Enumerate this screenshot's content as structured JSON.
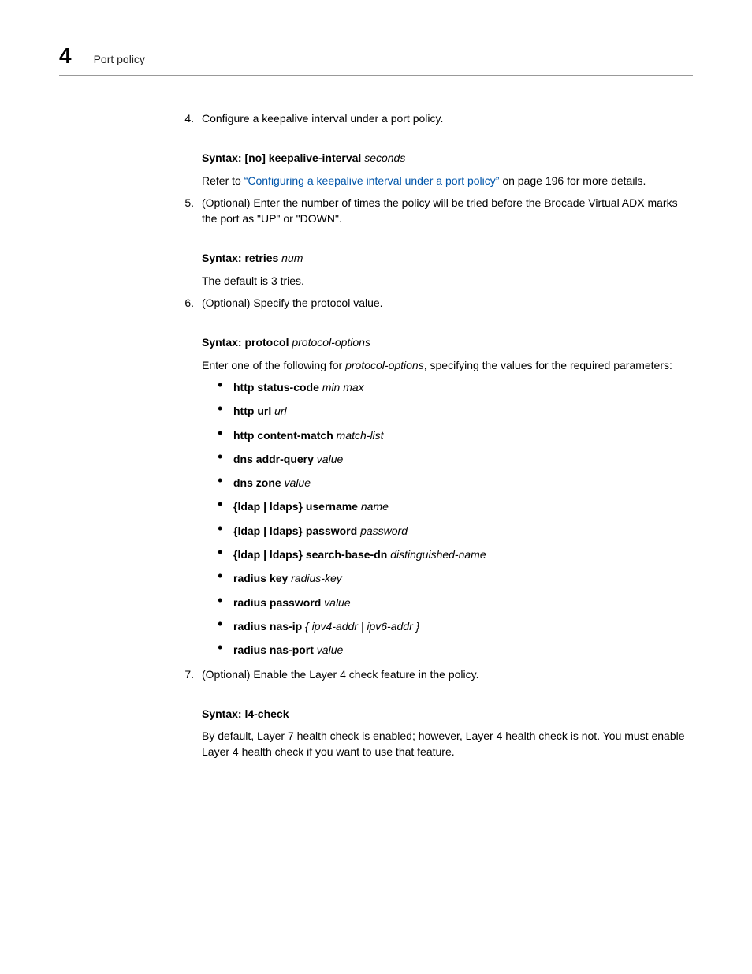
{
  "header": {
    "chapter_number": "4",
    "section_title": "Port policy"
  },
  "steps": [
    {
      "num": "4.",
      "text": "Configure a keepalive interval under a port policy.",
      "syntax_label": "Syntax:",
      "syntax_cmd": "[no] keepalive-interval",
      "syntax_arg": "seconds",
      "refer_prefix": "Refer to ",
      "refer_link": "“Configuring a keepalive interval under a port policy”",
      "refer_suffix": " on page 196 for more details."
    },
    {
      "num": "5.",
      "text": "(Optional) Enter the number of times the policy will be tried before the Brocade Virtual ADX marks the port as \"UP\" or \"DOWN\".",
      "syntax_label": "Syntax:",
      "syntax_cmd": " retries",
      "syntax_arg": "num",
      "note": "The default is 3 tries."
    },
    {
      "num": "6.",
      "text": "(Optional) Specify the protocol value.",
      "syntax_label": "Syntax:",
      "syntax_cmd": "protocol",
      "syntax_arg": "protocol-options",
      "intro_prefix": "Enter one of the following for ",
      "intro_italic": "protocol-options",
      "intro_suffix": ", specifying the values for the required parameters:",
      "bullets": [
        {
          "bold": "http status-code",
          "italic": "min max"
        },
        {
          "bold": "http url",
          "italic": "url"
        },
        {
          "bold": "http content-match",
          "italic": "match-list"
        },
        {
          "bold": "dns addr-query",
          "italic": "value"
        },
        {
          "bold": "dns zone",
          "italic": "value"
        },
        {
          "bold": "{ldap | ldaps} username",
          "italic": "name"
        },
        {
          "bold": "{ldap | ldaps} password",
          "italic": "password"
        },
        {
          "bold": "{ldap | ldaps} search-base-dn",
          "italic": "distinguished-name"
        },
        {
          "bold": "radius key",
          "italic": "radius-key"
        },
        {
          "bold": "radius password",
          "italic": "value"
        },
        {
          "bold": "radius nas-ip",
          "italic": "{ ipv4-addr | ipv6-addr }"
        },
        {
          "bold": "radius nas-port",
          "italic": "value"
        }
      ]
    },
    {
      "num": "7.",
      "text": "(Optional) Enable the Layer 4 check feature in the policy.",
      "syntax_label": "Syntax:",
      "syntax_cmd": "l4-check",
      "note": "By default, Layer 7 health check is enabled; however, Layer 4 health check is not. You must enable Layer 4 health check if you want to use that feature."
    }
  ]
}
